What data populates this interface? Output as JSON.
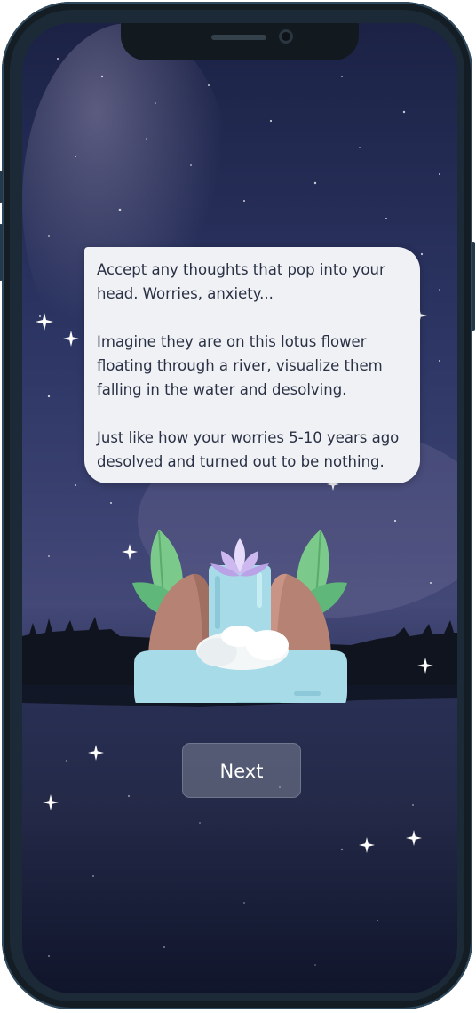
{
  "message": {
    "paragraph_1": "Accept any thoughts that pop into your head. Worries, anxiety...",
    "paragraph_2": "Imagine they are on this lotus flower floating through a river, visualize them falling in the water and desolving.",
    "paragraph_3": "Just like how your worries 5-10 years ago desolved and turned out to be nothing."
  },
  "next_button": {
    "label": "Next"
  },
  "colors": {
    "sky_top": "#1d2447",
    "sky_mid": "#3a4070",
    "bubble_bg": "#eff1f5",
    "bubble_text": "#2a3144",
    "water": "#a7dbe8",
    "rock": "#b58273",
    "leaf": "#5fb77a",
    "lotus": "#d8c8f2"
  },
  "icons": {
    "illustration": "waterfall-lotus-illustration",
    "sparkle": "sparkle-icon"
  }
}
